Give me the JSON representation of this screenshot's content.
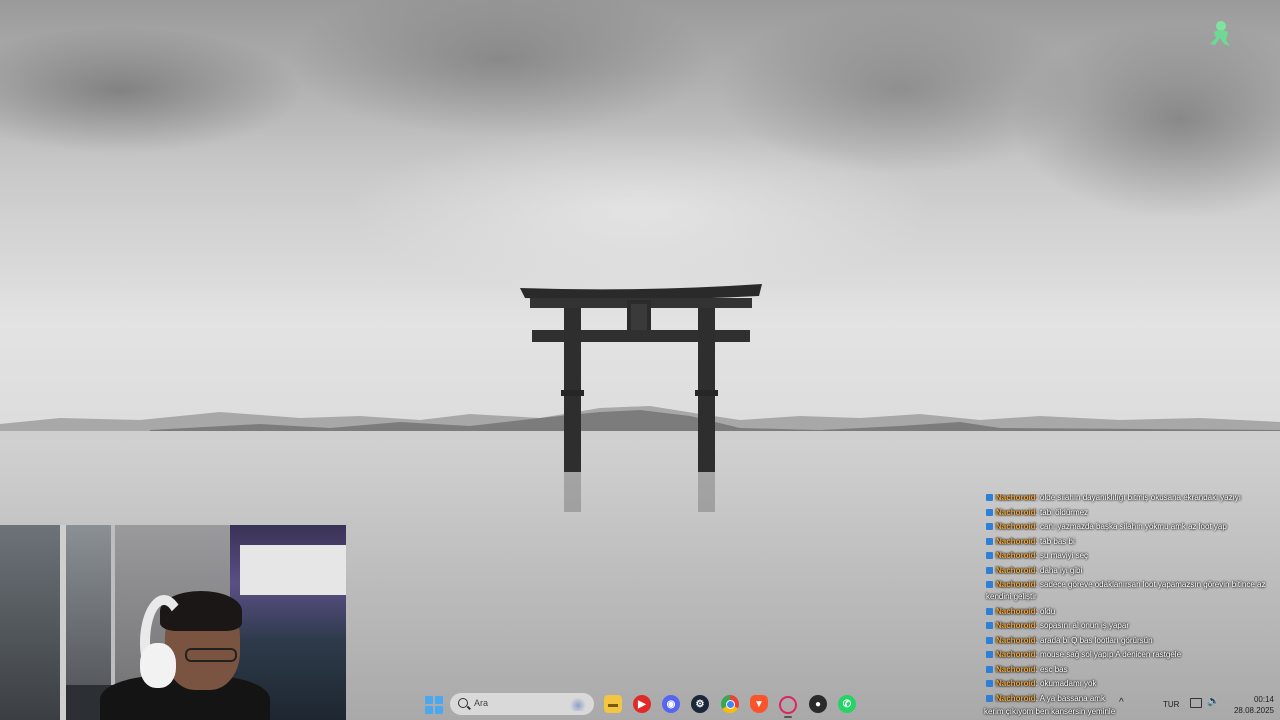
{
  "wallpaper": {
    "description_icon": "torii-gate-landscape"
  },
  "chat": {
    "messages": [
      {
        "user": "Nachoroid",
        "text": "ölde silahın dayanıklılığı bitmiş okusana ekrandaki yazıyı"
      },
      {
        "user": "Nachoroid",
        "text": "tabi öldürmez"
      },
      {
        "user": "Nachoroid",
        "text": "canı yazmazda başka silahın yokmu amk az loot yap"
      },
      {
        "user": "Nachoroid",
        "text": "tab bas bi"
      },
      {
        "user": "Nachoroid",
        "text": "şu maviyi seç"
      },
      {
        "user": "Nachoroid",
        "text": "daha iyi gibi"
      },
      {
        "user": "Nachoroid",
        "text": "sadece göreve odaklanırsan loot yapamazsın görevin bitince az kendini geliştir"
      },
      {
        "user": "Nachoroid",
        "text": "oldu"
      },
      {
        "user": "Nachoroid",
        "text": "sopasını al onun iş yapar"
      },
      {
        "user": "Nachoroid",
        "text": "arada bi Q bas lootları görürsün"
      },
      {
        "user": "Nachoroid",
        "text": "mouse sağ sol yapıp A denicen rastgele"
      },
      {
        "user": "Nachoroid",
        "text": "esc bas"
      },
      {
        "user": "Nachoroid",
        "text": "okumadamı yok"
      },
      {
        "user": "Nachoroid",
        "text": "A ya bassana amk"
      }
    ],
    "separator": ":",
    "bottom_line": "kerim çıkıyom ben kansersin yeminle",
    "username_color": "#f0a53a",
    "badge_color": "#2f7fd6"
  },
  "taskbar": {
    "search_placeholder": "Ara",
    "apps": [
      {
        "name": "file-explorer-icon"
      },
      {
        "name": "youtube-icon"
      },
      {
        "name": "discord-icon"
      },
      {
        "name": "steam-icon"
      },
      {
        "name": "chrome-icon"
      },
      {
        "name": "brave-icon"
      },
      {
        "name": "opera-gx-icon"
      },
      {
        "name": "obs-icon"
      },
      {
        "name": "whatsapp-icon"
      }
    ],
    "tray": {
      "language": "TUR"
    },
    "clock": {
      "time": "00:14",
      "date": "28.08.2025"
    }
  }
}
